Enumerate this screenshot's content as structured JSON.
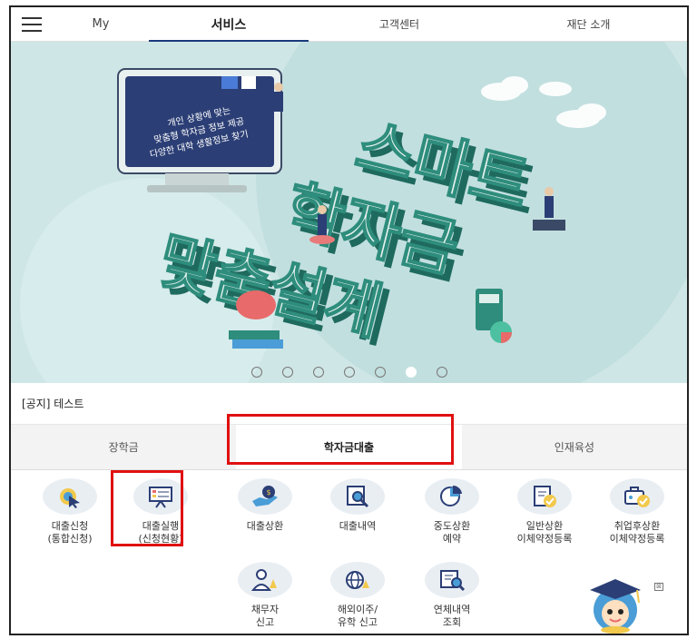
{
  "nav": {
    "menu_icon": "hamburger-icon",
    "tabs": [
      {
        "label": "My"
      },
      {
        "label": "서비스"
      },
      {
        "label": "고객센터"
      },
      {
        "label": "재단 소개"
      }
    ]
  },
  "banner": {
    "monitor_lines": [
      "개인 상황에 맞는",
      "맞춤형 학자금 정보 제공",
      "다양한 대학 생활정보 찾기"
    ],
    "headline_lines": [
      "스마트",
      "학자금",
      "맞춤설계"
    ],
    "slide_count": 7,
    "active_slide": 6,
    "colors": {
      "bg": "#cfe6e6",
      "block": "#2e8d7c",
      "block_light": "#eaf3f1"
    }
  },
  "notice": {
    "text": "[공지] 테스트"
  },
  "category_tabs": [
    {
      "label": "장학금"
    },
    {
      "label": "학자금대출"
    },
    {
      "label": "인재육성"
    }
  ],
  "services": [
    {
      "label": "대출신청\n(통합신청)",
      "icon": "cursor-click-icon"
    },
    {
      "label": "대출실행\n(신청현황)",
      "icon": "presentation-board-icon"
    },
    {
      "label": "대출상환",
      "icon": "money-bag-hand-icon"
    },
    {
      "label": "대출내역",
      "icon": "magnifier-document-icon"
    },
    {
      "label": "중도상환\n예약",
      "icon": "pie-chart-icon"
    },
    {
      "label": "일반상환\n이체약정등록",
      "icon": "document-check-icon"
    },
    {
      "label": "취업후상환\n이체약정등록",
      "icon": "briefcase-check-icon"
    },
    {
      "label": "채무자\n신고",
      "icon": "person-alert-icon"
    },
    {
      "label": "해외이주/\n유학 신고",
      "icon": "globe-alert-icon"
    },
    {
      "label": "연체내역\n조회",
      "icon": "list-search-icon"
    }
  ],
  "mascot": {
    "icon": "mascot-graduate-icon",
    "close_label": "⊠"
  }
}
